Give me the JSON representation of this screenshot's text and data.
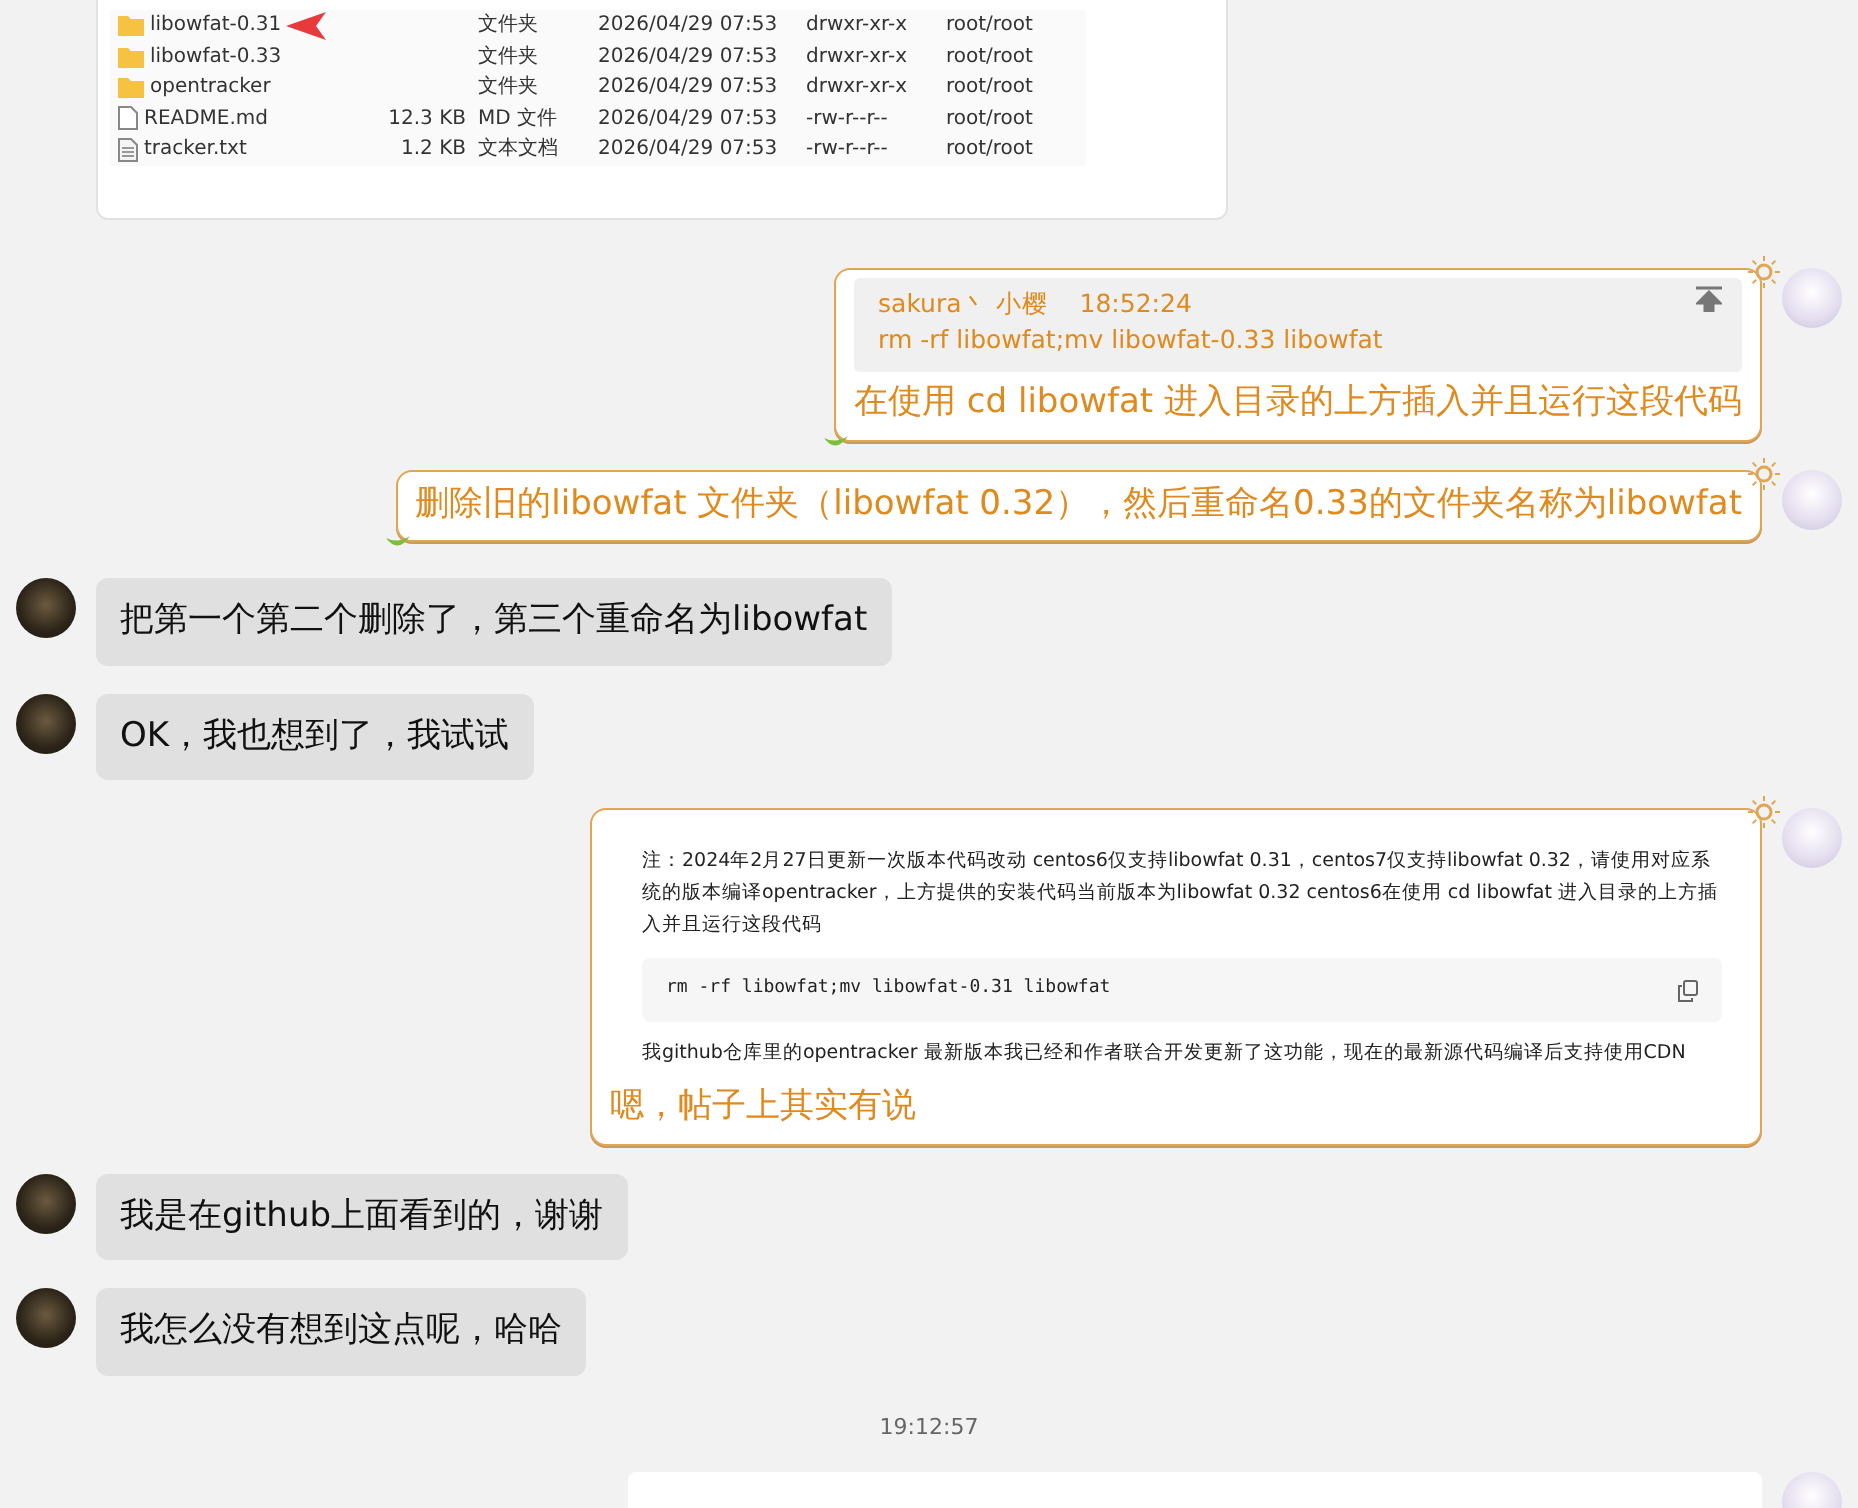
{
  "file_listing": {
    "rows": [
      {
        "kind": "folder",
        "name": "libowfat-0.31",
        "size": "",
        "type": "文件夹",
        "modified": "2026/04/29 07:53",
        "permissions": "drwxr-xr-x",
        "owner": "root/root",
        "marked": true
      },
      {
        "kind": "folder",
        "name": "libowfat-0.33",
        "size": "",
        "type": "文件夹",
        "modified": "2026/04/29 07:53",
        "permissions": "drwxr-xr-x",
        "owner": "root/root",
        "marked": false
      },
      {
        "kind": "folder",
        "name": "opentracker",
        "size": "",
        "type": "文件夹",
        "modified": "2026/04/29 07:53",
        "permissions": "drwxr-xr-x",
        "owner": "root/root",
        "marked": false
      },
      {
        "kind": "file",
        "name": "README.md",
        "size": "12.3 KB",
        "type": "MD 文件",
        "modified": "2026/04/29 07:53",
        "permissions": "-rw-r--r--",
        "owner": "root/root",
        "marked": false
      },
      {
        "kind": "text",
        "name": "tracker.txt",
        "size": "1.2 KB",
        "type": "文本文档",
        "modified": "2026/04/29 07:53",
        "permissions": "-rw-r--r--",
        "owner": "root/root",
        "marked": false
      }
    ]
  },
  "messages": [
    {
      "kind": "outgoing",
      "quote": {
        "sender": "sakura丶 小樱",
        "time": "18:52:24",
        "text": "rm -rf libowfat;mv libowfat-0.33 libowfat"
      },
      "text": "在使用 cd libowfat 进入目录的上方插入并且运行这段代码"
    },
    {
      "kind": "outgoing",
      "text": "删除旧的libowfat 文件夹（libowfat 0.32），然后重命名0.33的文件夹名称为libowfat"
    },
    {
      "kind": "incoming",
      "text": "把第一个第二个删除了，第三个重命名为libowfat"
    },
    {
      "kind": "incoming",
      "text": "OK，我也想到了，我试试"
    },
    {
      "kind": "outgoing",
      "attachment": {
        "note": "注：2024年2月27日更新一次版本代码改动 centos6仅支持libowfat 0.31，centos7仅支持libowfat 0.32，请使用对应系统的版本编译opentracker，上方提供的安装代码当前版本为libowfat 0.32 centos6在使用 cd libowfat 进入目录的上方插入并且运行这段代码",
        "code": "rm -rf libowfat;mv libowfat-0.31 libowfat",
        "footer": "我github仓库里的opentracker 最新版本我已经和作者联合开发更新了这功能，现在的最新源代码编译后支持使用CDN"
      },
      "text": "嗯，帖子上其实有说"
    },
    {
      "kind": "incoming",
      "text": "我是在github上面看到的，谢谢"
    },
    {
      "kind": "incoming",
      "text": "我怎么没有想到这点呢，哈哈"
    },
    {
      "kind": "timestamp",
      "text": "19:12:57"
    },
    {
      "kind": "outgoing_image"
    }
  ]
}
